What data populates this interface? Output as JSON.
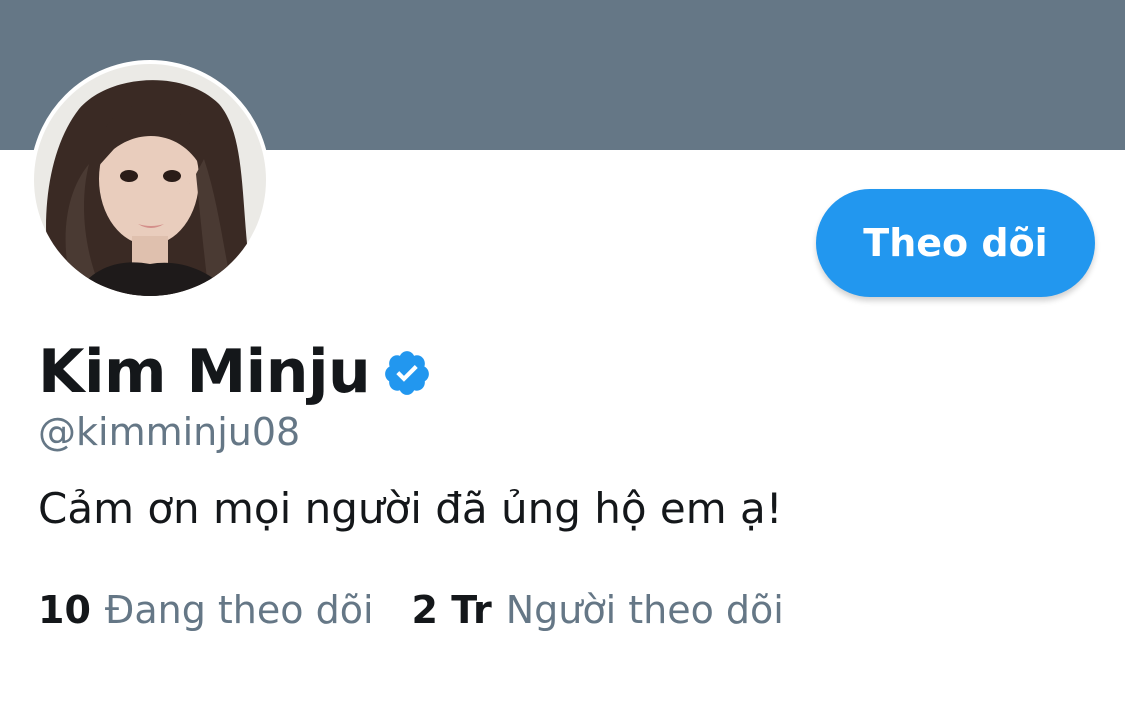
{
  "profile": {
    "display_name": "Kim Minju",
    "handle": "@kimminju08",
    "bio": "Cảm ơn mọi người đã ủng hộ em ạ!",
    "verified": true,
    "avatar_icon": "profile-photo"
  },
  "actions": {
    "follow_label": "Theo dõi"
  },
  "stats": {
    "following": {
      "count": "10",
      "label": "Đang theo dõi"
    },
    "followers": {
      "count": "2 Tr",
      "label": "Người theo dõi"
    }
  },
  "colors": {
    "banner": "#657786",
    "accent": "#2297ef",
    "text_primary": "#14171a",
    "text_secondary": "#657786"
  }
}
